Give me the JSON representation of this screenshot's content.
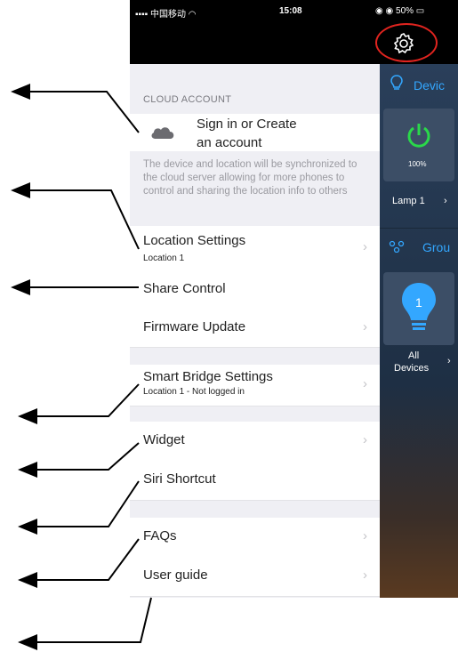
{
  "status": {
    "carrier": "中国移动",
    "time": "15:08",
    "battery": "50%"
  },
  "menu": {
    "cloud_header": "CLOUD ACCOUNT",
    "signin_line1": "Sign in or Create",
    "signin_line2": "an account",
    "cloud_note": "The device and location will be synchronized to the cloud server allowing for more phones to control and sharing the location info to others",
    "location_settings": "Location Settings",
    "location_sub": "Location 1",
    "share_control": "Share Control",
    "firmware_update": "Firmware Update",
    "smart_bridge": "Smart Bridge Settings",
    "smart_bridge_sub": "Location 1 - Not logged in",
    "widget": "Widget",
    "siri": "Siri Shortcut",
    "faqs": "FAQs",
    "user_guide": "User guide"
  },
  "right_panel": {
    "devices_tab": "Devic",
    "power_pct": "100%",
    "lamp": "Lamp 1",
    "groups_tab": "Grou",
    "group_count": "1",
    "all_devices_1": "All",
    "all_devices_2": "Devices"
  },
  "colors": {
    "accent_green": "#2ad84a",
    "accent_blue": "#33a7ff",
    "highlight_red": "#e0241f"
  },
  "icons": [
    "signal-icon",
    "wifi-icon",
    "battery-icon",
    "gear-icon",
    "cloud-icon",
    "chevron-right-icon",
    "bulb-icon",
    "power-icon",
    "group-icon"
  ]
}
